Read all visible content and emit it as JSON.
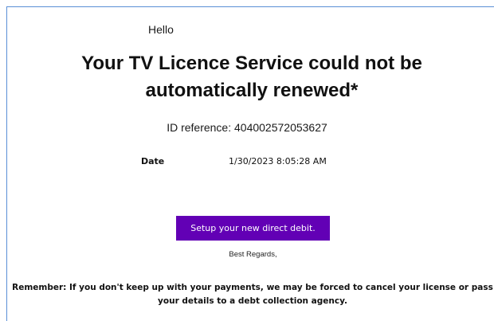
{
  "email": {
    "greeting": "Hello",
    "headline": "Your TV Licence Service could not be automatically renewed*",
    "reference": "ID reference: 404002572053627",
    "date_label": "Date",
    "date_value": "1/30/2023 8:05:28 AM",
    "cta_label": "Setup your new direct debit.",
    "sign_off": "Best Regards,",
    "reminder": "Remember: If you don't keep up with your payments, we may be forced to cancel your license or pass your details to a debt collection agency."
  },
  "colors": {
    "cta_background": "#6200b5",
    "cta_text": "#ffffff",
    "frame_border": "#5a8fd6",
    "text": "#111111"
  }
}
